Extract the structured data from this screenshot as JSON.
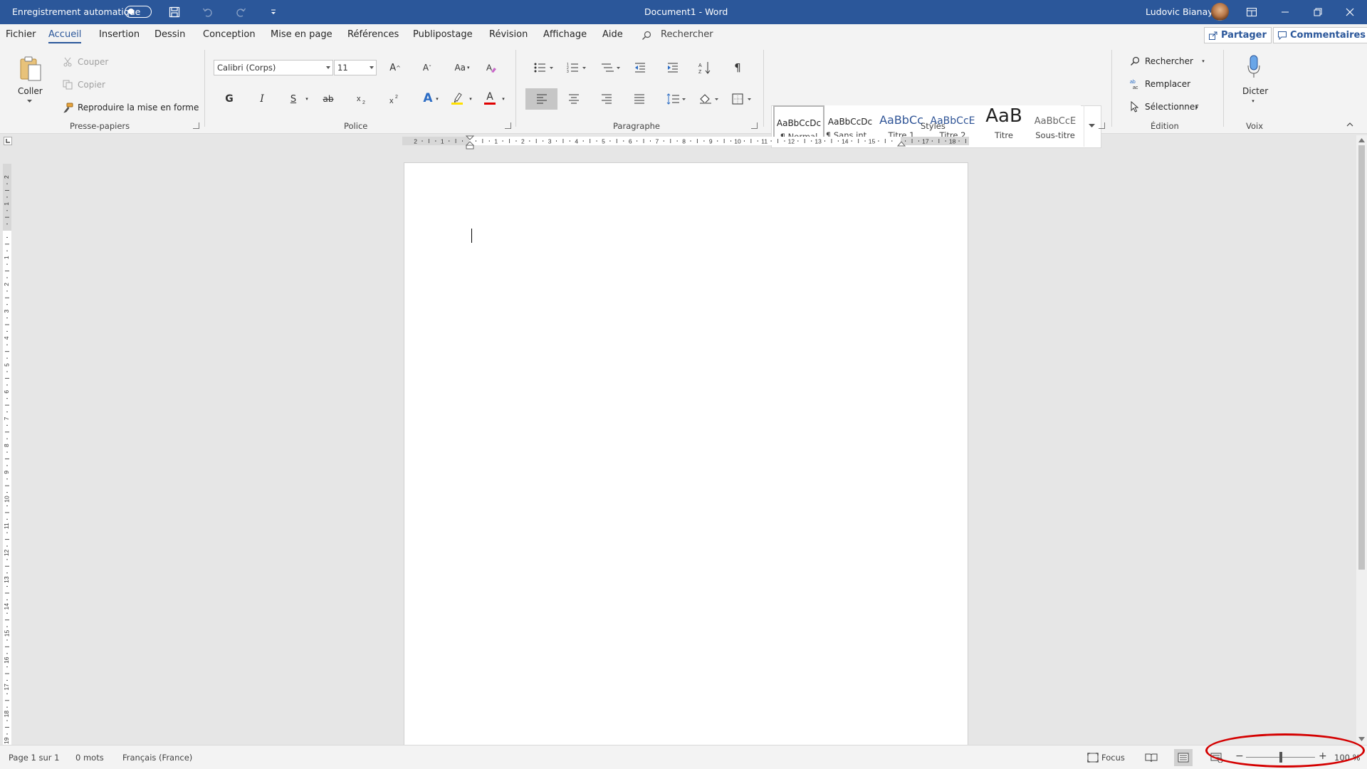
{
  "titlebar": {
    "autosave_label": "Enregistrement automatique",
    "doc_title": "Document1  -  Word",
    "user_name": "Ludovic Bianay",
    "bg_color": "#2b579a"
  },
  "tabs": {
    "items": [
      "Fichier",
      "Accueil",
      "Insertion",
      "Dessin",
      "Conception",
      "Mise en page",
      "Références",
      "Publipostage",
      "Révision",
      "Affichage",
      "Aide"
    ],
    "active": "Accueil",
    "search_label": "Rechercher",
    "share_label": "Partager",
    "comments_label": "Commentaires"
  },
  "clipboard": {
    "paste_label": "Coller",
    "cut_label": "Couper",
    "copy_label": "Copier",
    "format_painter_label": "Reproduire la mise en forme",
    "group_label": "Presse-papiers"
  },
  "font": {
    "font_name": "Calibri (Corps)",
    "font_size": "11",
    "bold_label": "G",
    "italic_label": "I",
    "underline_label": "S",
    "strike_label": "ab",
    "grow_label": "A",
    "shrink_label": "A",
    "case_label": "Aa",
    "text_effects_label": "A",
    "font_color_label": "A",
    "highlight_color": "#ffe000",
    "font_color": "#e00000",
    "group_label": "Police"
  },
  "paragraph": {
    "group_label": "Paragraphe"
  },
  "styles": {
    "items": [
      {
        "preview": "AaBbCcDc",
        "name": "¶ Normal"
      },
      {
        "preview": "AaBbCcDc",
        "name": "¶ Sans int..."
      },
      {
        "preview": "AaBbCc",
        "name": "Titre 1"
      },
      {
        "preview": "AaBbCcE",
        "name": "Titre 2"
      },
      {
        "preview": "AaB",
        "name": "Titre"
      },
      {
        "preview": "AaBbCcE",
        "name": "Sous-titre"
      }
    ],
    "group_label": "Styles"
  },
  "editing": {
    "find_label": "Rechercher",
    "replace_label": "Remplacer",
    "select_label": "Sélectionner",
    "group_label": "Édition"
  },
  "voice": {
    "dictate_label": "Dicter",
    "group_label": "Voix"
  },
  "ruler": {
    "horizontal_labels": [
      "2",
      "1",
      "",
      "1",
      "2",
      "3",
      "4",
      "5",
      "6",
      "7",
      "8",
      "9",
      "10",
      "11",
      "12",
      "13",
      "14",
      "15",
      "",
      "17",
      "18"
    ],
    "vertical_labels": [
      "2",
      "1",
      "",
      "1",
      "2",
      "3",
      "4",
      "5",
      "6",
      "7",
      "8",
      "9",
      "10",
      "11",
      "12",
      "13",
      "14",
      "15",
      "16",
      "17",
      "18",
      "19"
    ]
  },
  "statusbar": {
    "page_info": "Page 1 sur 1",
    "word_count": "0 mots",
    "language": "Français (France)",
    "focus_label": "Focus",
    "zoom_minus": "−",
    "zoom_plus": "+",
    "zoom_level": "100 %",
    "zoom_fraction": 0.5,
    "highlight_color": "#d40000"
  }
}
